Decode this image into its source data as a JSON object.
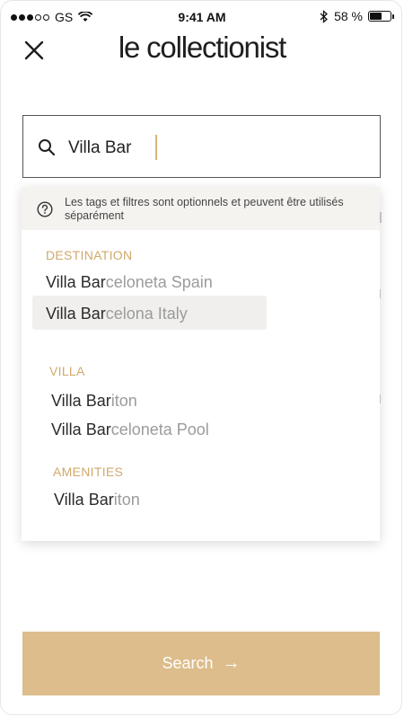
{
  "status_bar": {
    "carrier": "GS",
    "time": "9:41 AM",
    "battery_percent_label": "58 %",
    "battery_level": 0.58
  },
  "header": {
    "logo_text": "le collectionist",
    "close_icon": "close-icon"
  },
  "search": {
    "value": "Villa Bar",
    "icon": "search-icon"
  },
  "dropdown": {
    "hint": "Les tags et filtres sont optionnels et peuvent être utilisés séparément",
    "hint_icon": "question-circle-icon",
    "sections": [
      {
        "title": "DESTINATION",
        "items": [
          {
            "match": "Villa Bar",
            "rest": "celoneta Spain"
          },
          {
            "match": "Villa Bar",
            "rest": "celona Italy"
          }
        ]
      },
      {
        "title": "VILLA",
        "items": [
          {
            "match": "Villa Bar",
            "rest": "iton"
          },
          {
            "match": "Villa Bar",
            "rest": "celoneta Pool"
          }
        ]
      },
      {
        "title": "AMENITIES",
        "items": [
          {
            "match": "Villa Bar",
            "rest": "iton"
          }
        ]
      }
    ]
  },
  "search_button": {
    "label": "Search",
    "arrow": "→"
  },
  "colors": {
    "accent": "#dcbd8b",
    "section_title": "#d0a96c",
    "highlight_bg": "#f0efed",
    "hint_bg": "#f4f3f0"
  }
}
